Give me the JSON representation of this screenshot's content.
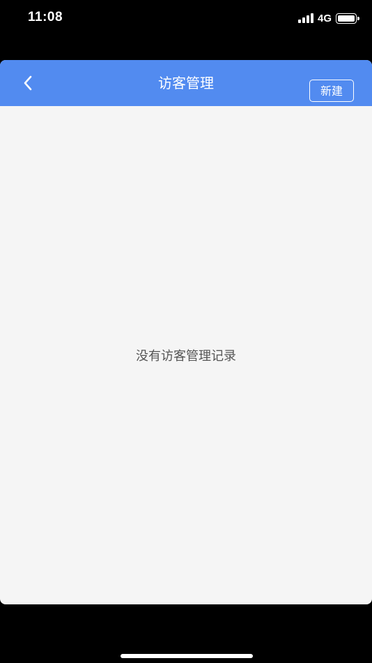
{
  "status_bar": {
    "time": "11:08",
    "network": "4G",
    "signal_icon": "signal-bars-icon",
    "battery_icon": "battery-full-icon"
  },
  "nav": {
    "back_icon": "chevron-left-icon",
    "title": "访客管理",
    "new_button_label": "新建"
  },
  "content": {
    "empty_message": "没有访客管理记录"
  },
  "colors": {
    "nav_background": "#528bf0",
    "content_background": "#f5f5f5",
    "empty_text": "#555555"
  }
}
